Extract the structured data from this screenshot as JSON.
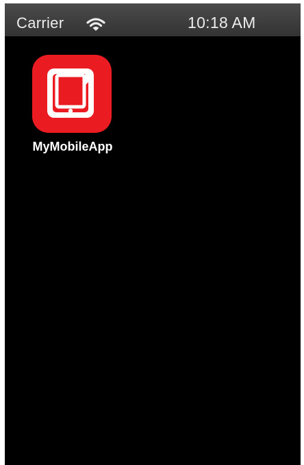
{
  "status_bar": {
    "carrier": "Carrier",
    "wifi_icon": "wifi-icon",
    "time": "10:18 AM"
  },
  "home_screen": {
    "apps": [
      {
        "label": "MyMobileApp",
        "icon": "tablet-app-icon",
        "icon_color": "#ea1c22"
      }
    ]
  }
}
